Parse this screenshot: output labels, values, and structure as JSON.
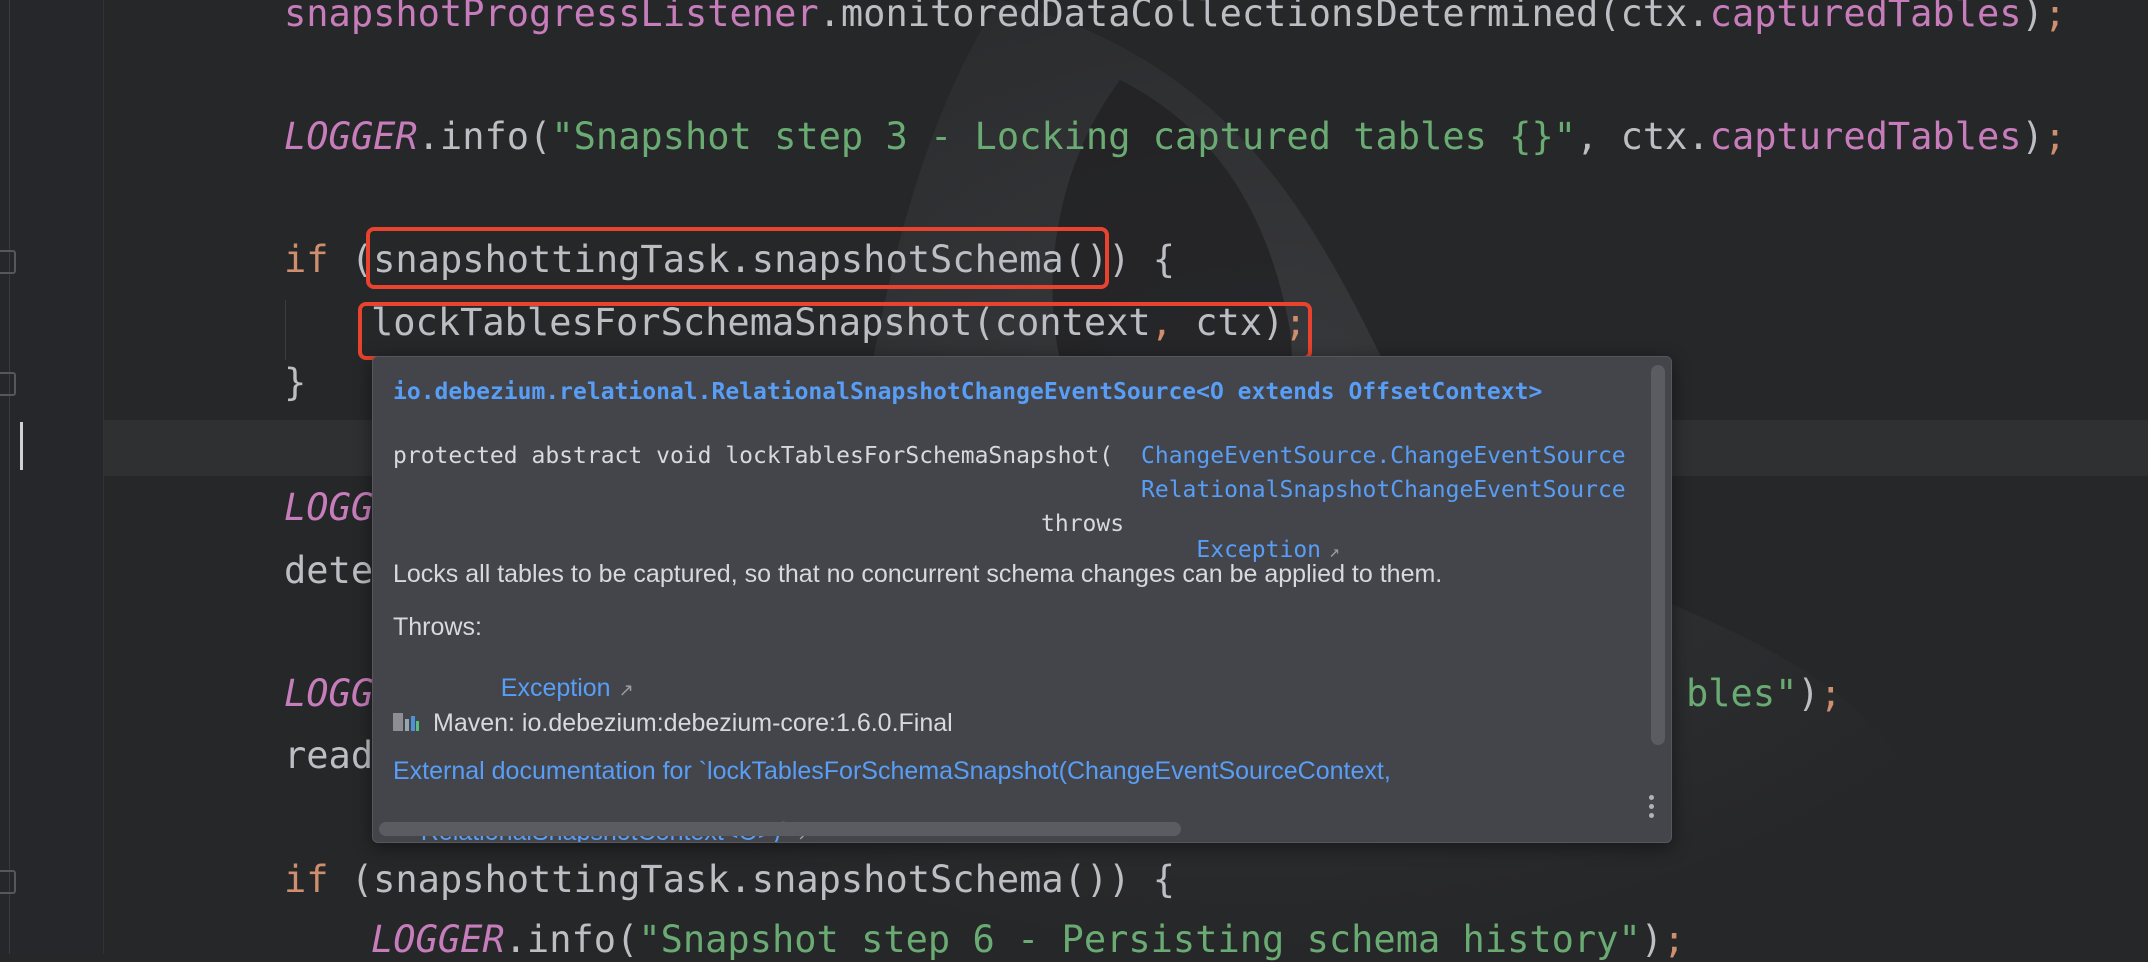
{
  "editor": {
    "lines": [
      {
        "segments": [
          {
            "t": "snapshotProgressListener",
            "c": "fld"
          },
          {
            "t": ".monitoredDataCollectionsDetermined(ctx.",
            "c": "punct"
          },
          {
            "t": "capturedTables",
            "c": "fld"
          },
          {
            "t": ")",
            "c": "punct"
          },
          {
            "t": ";",
            "c": "semi"
          }
        ]
      },
      {
        "segments": [
          {
            "t": "LOGGER",
            "c": "stat"
          },
          {
            "t": ".info(",
            "c": "punct"
          },
          {
            "t": "\"Snapshot step 3 - Locking captured tables {}\"",
            "c": "str"
          },
          {
            "t": ", ctx.",
            "c": "punct"
          },
          {
            "t": "capturedTables",
            "c": "fld"
          },
          {
            "t": ")",
            "c": "punct"
          },
          {
            "t": ";",
            "c": "semi"
          }
        ]
      },
      {
        "segments": [
          {
            "t": "if",
            "c": "kw"
          },
          {
            "t": " (snapshottingTask.snapshotSchema()) {",
            "c": "punct"
          }
        ]
      },
      {
        "segments": [
          {
            "t": "lockTablesForSchemaSnapshot(context",
            "c": "punct"
          },
          {
            "t": ",",
            "c": "semi"
          },
          {
            "t": " ctx)",
            "c": "punct"
          },
          {
            "t": ";",
            "c": "semi"
          }
        ]
      },
      {
        "segments": [
          {
            "t": "}",
            "c": "punct"
          }
        ]
      },
      {
        "segments": [
          {
            "t": "LOGG",
            "c": "stat"
          }
        ]
      },
      {
        "segments": [
          {
            "t": "dete",
            "c": "punct"
          }
        ]
      },
      {
        "segments": [
          {
            "t": "LOGG",
            "c": "stat"
          }
        ]
      },
      {
        "segments": [
          {
            "t": "bles\"",
            "c": "str"
          },
          {
            "t": ")",
            "c": "punct"
          },
          {
            "t": ";",
            "c": "semi"
          }
        ]
      },
      {
        "segments": [
          {
            "t": "read",
            "c": "punct"
          }
        ]
      },
      {
        "segments": [
          {
            "t": "if",
            "c": "kw"
          },
          {
            "t": " (snapshottingTask.snapshotSchema()) {",
            "c": "punct"
          }
        ]
      },
      {
        "segments": [
          {
            "t": "LOGGER",
            "c": "stat"
          },
          {
            "t": ".info(",
            "c": "punct"
          },
          {
            "t": "\"Snapshot step 6 - Persisting schema history\"",
            "c": "str"
          },
          {
            "t": ")",
            "c": "punct"
          },
          {
            "t": ";",
            "c": "semi"
          }
        ]
      }
    ]
  },
  "popup": {
    "class_name": "io.debezium.relational.RelationalSnapshotChangeEventSource<O extends OffsetContext>",
    "signature_prefix": "protected abstract void lockTablesForSchemaSnapshot(",
    "param1": "ChangeEventSource.ChangeEventSource",
    "param2": "RelationalSnapshotChangeEventSource",
    "throws_kw": "throws",
    "throws_type": "Exception",
    "description": "Locks all tables to be captured, so that no concurrent schema changes can be applied to them.",
    "throws_label": "Throws:",
    "throws_item": "Exception",
    "maven_label": "Maven: io.debezium:debezium-core:1.6.0.Final",
    "external_doc_line1": "External documentation for `lockTablesForSchemaSnapshot(ChangeEventSourceContext,",
    "external_doc_line2": "RelationalSnapshotContext<O>)`",
    "arrow_glyph": "↗"
  },
  "colors": {
    "background": "#262729",
    "keyword": "#cf8e6d",
    "field": "#c77dbb",
    "string": "#6aab73",
    "text": "#bcbec4",
    "link": "#589df6",
    "highlight_box": "#e8432e",
    "popup_bg": "#43454a"
  }
}
